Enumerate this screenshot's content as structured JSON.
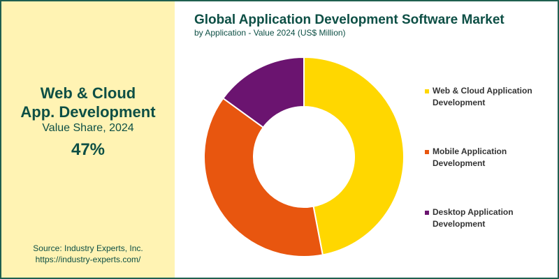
{
  "highlight": {
    "title_line1": "Web & Cloud",
    "title_line2": "App. Development",
    "subtitle": "Value Share, 2024",
    "value": "47%"
  },
  "source": {
    "line1": "Source: Industry Experts, Inc.",
    "line2": "https://industry-experts.com/"
  },
  "colors": {
    "border": "#1f5f4f",
    "left_panel": "#fff3b3",
    "text": "#0d4f45"
  },
  "chart_data": {
    "type": "pie",
    "variant": "donut",
    "title": "Global Application Development Software Market",
    "subtitle": "by Application - Value 2024 (US$ Million)",
    "categories": [
      "Web & Cloud Application Development",
      "Mobile Application Development",
      "Desktop Application Development"
    ],
    "values": [
      47,
      38,
      15
    ],
    "colors": [
      "#ffd700",
      "#e8560f",
      "#6b1470"
    ],
    "legend_position": "right"
  }
}
